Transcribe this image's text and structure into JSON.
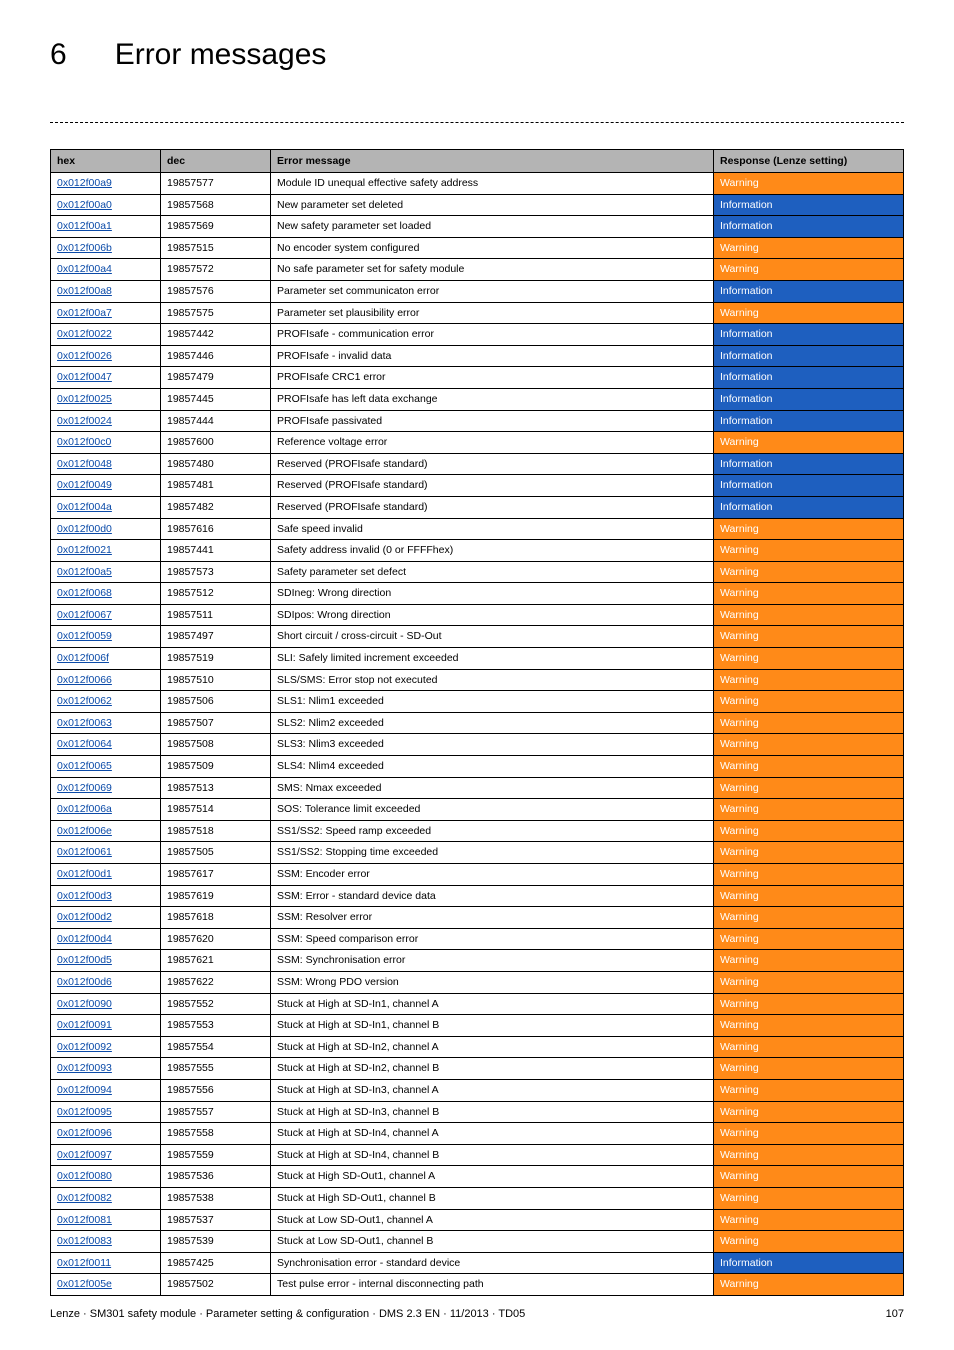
{
  "chapter": {
    "number": "6",
    "title": "Error messages"
  },
  "table": {
    "headers": {
      "hex": "hex",
      "dec": "dec",
      "msg": "Error message",
      "resp": "Response (Lenze setting)"
    },
    "rows": [
      {
        "hex": "0x012f00a9",
        "dec": "19857577",
        "msg": "Module ID unequal effective safety address",
        "resp": "Warning"
      },
      {
        "hex": "0x012f00a0",
        "dec": "19857568",
        "msg": "New parameter set deleted",
        "resp": "Information"
      },
      {
        "hex": "0x012f00a1",
        "dec": "19857569",
        "msg": "New safety parameter set loaded",
        "resp": "Information"
      },
      {
        "hex": "0x012f006b",
        "dec": "19857515",
        "msg": "No encoder system configured",
        "resp": "Warning"
      },
      {
        "hex": "0x012f00a4",
        "dec": "19857572",
        "msg": "No safe parameter set for safety module",
        "resp": "Warning"
      },
      {
        "hex": "0x012f00a8",
        "dec": "19857576",
        "msg": "Parameter set communicaton error",
        "resp": "Information"
      },
      {
        "hex": "0x012f00a7",
        "dec": "19857575",
        "msg": "Parameter set plausibility error",
        "resp": "Warning"
      },
      {
        "hex": "0x012f0022",
        "dec": "19857442",
        "msg": "PROFIsafe - communication error",
        "resp": "Information"
      },
      {
        "hex": "0x012f0026",
        "dec": "19857446",
        "msg": "PROFIsafe - invalid data",
        "resp": "Information"
      },
      {
        "hex": "0x012f0047",
        "dec": "19857479",
        "msg": "PROFIsafe CRC1 error",
        "resp": "Information"
      },
      {
        "hex": "0x012f0025",
        "dec": "19857445",
        "msg": "PROFIsafe has left data exchange",
        "resp": "Information"
      },
      {
        "hex": "0x012f0024",
        "dec": "19857444",
        "msg": "PROFIsafe passivated",
        "resp": "Information"
      },
      {
        "hex": "0x012f00c0",
        "dec": "19857600",
        "msg": "Reference voltage error",
        "resp": "Warning"
      },
      {
        "hex": "0x012f0048",
        "dec": "19857480",
        "msg": "Reserved (PROFIsafe standard)",
        "resp": "Information"
      },
      {
        "hex": "0x012f0049",
        "dec": "19857481",
        "msg": "Reserved (PROFIsafe standard)",
        "resp": "Information"
      },
      {
        "hex": "0x012f004a",
        "dec": "19857482",
        "msg": "Reserved (PROFIsafe standard)",
        "resp": "Information"
      },
      {
        "hex": "0x012f00d0",
        "dec": "19857616",
        "msg": "Safe speed invalid",
        "resp": "Warning"
      },
      {
        "hex": "0x012f0021",
        "dec": "19857441",
        "msg": "Safety address invalid (0 or FFFFhex)",
        "resp": "Warning"
      },
      {
        "hex": "0x012f00a5",
        "dec": "19857573",
        "msg": "Safety parameter set defect",
        "resp": "Warning"
      },
      {
        "hex": "0x012f0068",
        "dec": "19857512",
        "msg": "SDIneg: Wrong direction",
        "resp": "Warning"
      },
      {
        "hex": "0x012f0067",
        "dec": "19857511",
        "msg": "SDIpos: Wrong direction",
        "resp": "Warning"
      },
      {
        "hex": "0x012f0059",
        "dec": "19857497",
        "msg": "Short circuit / cross-circuit - SD-Out",
        "resp": "Warning"
      },
      {
        "hex": "0x012f006f",
        "dec": "19857519",
        "msg": "SLI: Safely limited increment exceeded",
        "resp": "Warning"
      },
      {
        "hex": "0x012f0066",
        "dec": "19857510",
        "msg": "SLS/SMS: Error stop not executed",
        "resp": "Warning"
      },
      {
        "hex": "0x012f0062",
        "dec": "19857506",
        "msg": "SLS1: Nlim1 exceeded",
        "resp": "Warning"
      },
      {
        "hex": "0x012f0063",
        "dec": "19857507",
        "msg": "SLS2: Nlim2 exceeded",
        "resp": "Warning"
      },
      {
        "hex": "0x012f0064",
        "dec": "19857508",
        "msg": "SLS3: Nlim3 exceeded",
        "resp": "Warning"
      },
      {
        "hex": "0x012f0065",
        "dec": "19857509",
        "msg": "SLS4: Nlim4 exceeded",
        "resp": "Warning"
      },
      {
        "hex": "0x012f0069",
        "dec": "19857513",
        "msg": "SMS: Nmax exceeded",
        "resp": "Warning"
      },
      {
        "hex": "0x012f006a",
        "dec": "19857514",
        "msg": "SOS: Tolerance limit exceeded",
        "resp": "Warning"
      },
      {
        "hex": "0x012f006e",
        "dec": "19857518",
        "msg": "SS1/SS2: Speed ramp exceeded",
        "resp": "Warning"
      },
      {
        "hex": "0x012f0061",
        "dec": "19857505",
        "msg": "SS1/SS2: Stopping time exceeded",
        "resp": "Warning"
      },
      {
        "hex": "0x012f00d1",
        "dec": "19857617",
        "msg": "SSM: Encoder error",
        "resp": "Warning"
      },
      {
        "hex": "0x012f00d3",
        "dec": "19857619",
        "msg": "SSM: Error - standard device data",
        "resp": "Warning"
      },
      {
        "hex": "0x012f00d2",
        "dec": "19857618",
        "msg": "SSM: Resolver error",
        "resp": "Warning"
      },
      {
        "hex": "0x012f00d4",
        "dec": "19857620",
        "msg": "SSM: Speed comparison error",
        "resp": "Warning"
      },
      {
        "hex": "0x012f00d5",
        "dec": "19857621",
        "msg": "SSM: Synchronisation error",
        "resp": "Warning"
      },
      {
        "hex": "0x012f00d6",
        "dec": "19857622",
        "msg": "SSM: Wrong PDO version",
        "resp": "Warning"
      },
      {
        "hex": "0x012f0090",
        "dec": "19857552",
        "msg": "Stuck at High at SD-In1, channel A",
        "resp": "Warning"
      },
      {
        "hex": "0x012f0091",
        "dec": "19857553",
        "msg": "Stuck at High at SD-In1, channel B",
        "resp": "Warning"
      },
      {
        "hex": "0x012f0092",
        "dec": "19857554",
        "msg": "Stuck at High at SD-In2, channel A",
        "resp": "Warning"
      },
      {
        "hex": "0x012f0093",
        "dec": "19857555",
        "msg": "Stuck at High at SD-In2, channel B",
        "resp": "Warning"
      },
      {
        "hex": "0x012f0094",
        "dec": "19857556",
        "msg": "Stuck at High at SD-In3, channel A",
        "resp": "Warning"
      },
      {
        "hex": "0x012f0095",
        "dec": "19857557",
        "msg": "Stuck at High at SD-In3, channel B",
        "resp": "Warning"
      },
      {
        "hex": "0x012f0096",
        "dec": "19857558",
        "msg": "Stuck at High at SD-In4, channel A",
        "resp": "Warning"
      },
      {
        "hex": "0x012f0097",
        "dec": "19857559",
        "msg": "Stuck at High at SD-In4, channel B",
        "resp": "Warning"
      },
      {
        "hex": "0x012f0080",
        "dec": "19857536",
        "msg": "Stuck at High SD-Out1, channel A",
        "resp": "Warning"
      },
      {
        "hex": "0x012f0082",
        "dec": "19857538",
        "msg": "Stuck at High SD-Out1, channel B",
        "resp": "Warning"
      },
      {
        "hex": "0x012f0081",
        "dec": "19857537",
        "msg": "Stuck at Low SD-Out1, channel A",
        "resp": "Warning"
      },
      {
        "hex": "0x012f0083",
        "dec": "19857539",
        "msg": "Stuck at Low SD-Out1, channel B",
        "resp": "Warning"
      },
      {
        "hex": "0x012f0011",
        "dec": "19857425",
        "msg": "Synchronisation error - standard device",
        "resp": "Information"
      },
      {
        "hex": "0x012f005e",
        "dec": "19857502",
        "msg": "Test pulse error - internal disconnecting path",
        "resp": "Warning"
      }
    ]
  },
  "footer": {
    "left": "Lenze · SM301 safety module · Parameter setting & configuration · DMS 2.3 EN · 11/2013 · TD05",
    "page": "107"
  },
  "response_colors": {
    "Warning": "#ff8a18",
    "Information": "#1e5fbf"
  }
}
